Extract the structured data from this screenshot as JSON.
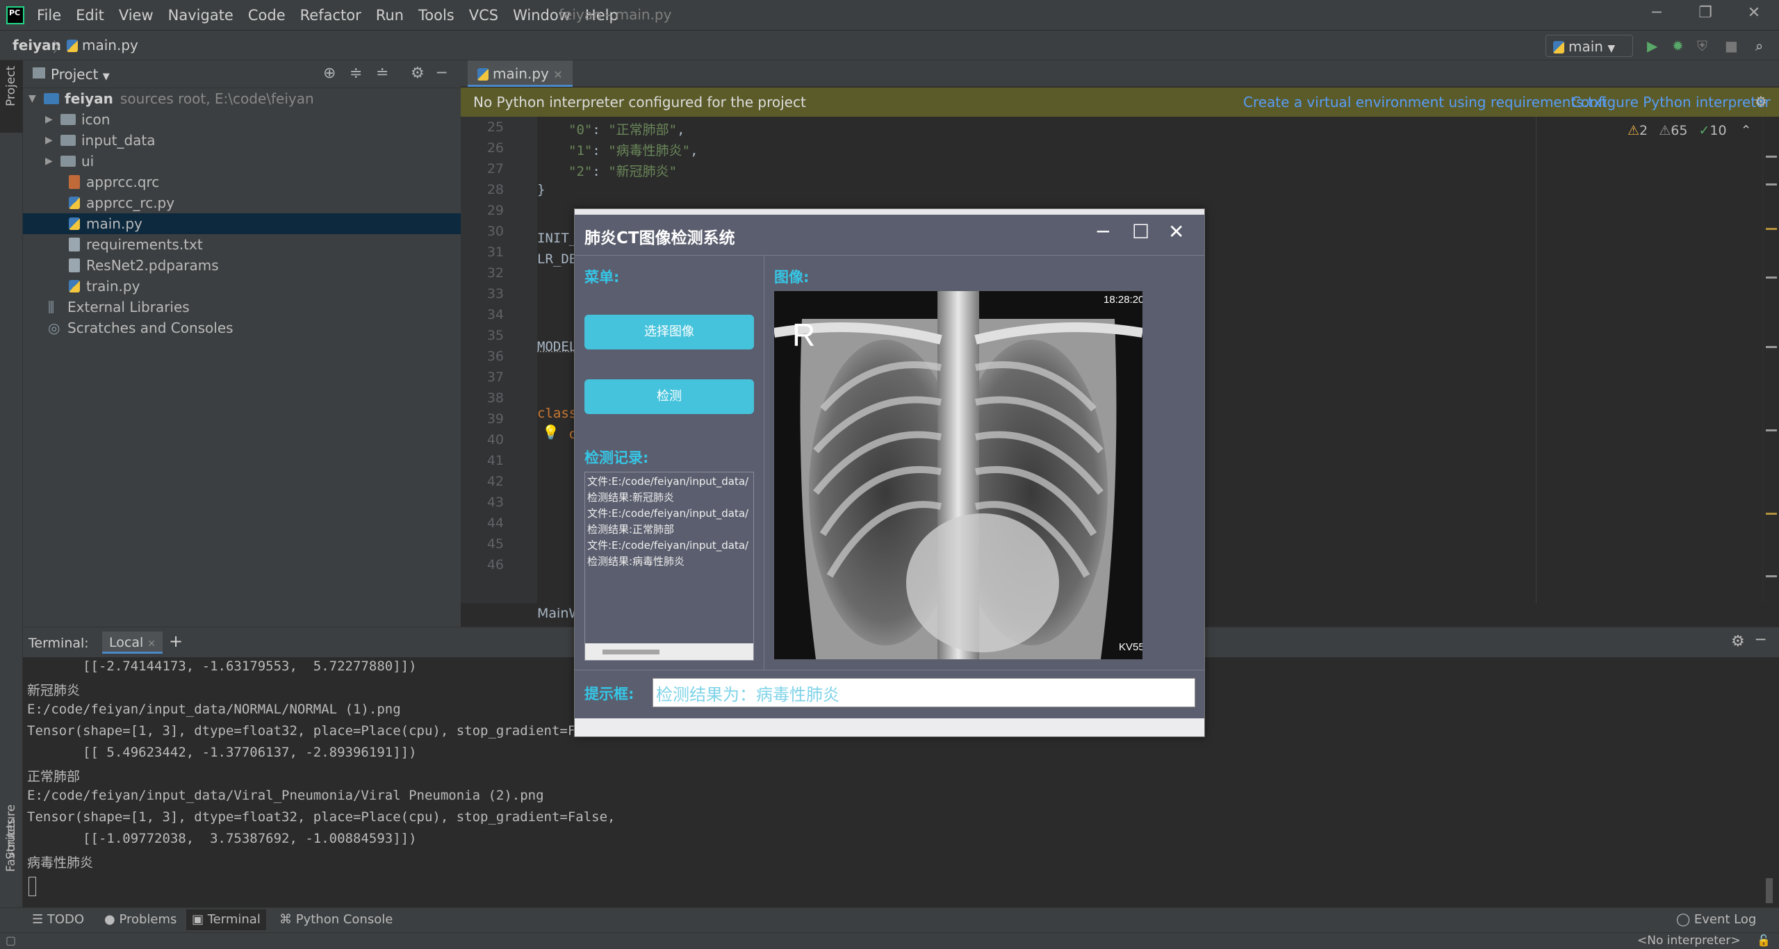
{
  "menu": [
    "File",
    "Edit",
    "View",
    "Navigate",
    "Code",
    "Refactor",
    "Run",
    "Tools",
    "VCS",
    "Window",
    "Help"
  ],
  "window_title": "feiyan - main.py",
  "nav": {
    "project": "feiyan",
    "file": "main.py",
    "run_config": "main"
  },
  "project_panel": {
    "title": "Project",
    "root_name": "feiyan",
    "root_hint": "sources root,  E:\\code\\feiyan",
    "folders": [
      "icon",
      "input_data",
      "ui"
    ],
    "files": [
      "apprcc.qrc",
      "apprcc_rc.py",
      "main.py",
      "requirements.txt",
      "ResNet2.pdparams",
      "train.py"
    ],
    "external": "External Libraries",
    "scratches": "Scratches and Consoles"
  },
  "editor": {
    "tab": "main.py",
    "banner_message": "No Python interpreter configured for the project",
    "banner_link_1": "Create a virtual environment using requirements.txt",
    "banner_link_2": "Configure Python interpreter",
    "inspections": {
      "warnings": "2",
      "weak": "65",
      "typos": "10"
    },
    "line_numbers": [
      "25",
      "26",
      "27",
      "28",
      "29",
      "30",
      "31",
      "32",
      "33",
      "34",
      "35",
      "36",
      "37",
      "38",
      "39",
      "40",
      "41",
      "42",
      "43",
      "44",
      "45",
      "46"
    ],
    "code_lines": {
      "l25_key": "\"0\"",
      "l25_val": "\"正常肺部\"",
      "l26_key": "\"1\"",
      "l26_val": "\"病毒性肺炎\"",
      "l27_key": "\"2\"",
      "l27_val": "\"新冠肺炎\"",
      "l28": "}",
      "l30": "INIT_",
      "l31": "LR_DE",
      "l35": "MODEL",
      "l38": "class",
      "l39": "d"
    },
    "breadcrumb": "MainW"
  },
  "terminal": {
    "label": "Terminal:",
    "tab": "Local",
    "lines": [
      "       [[-2.74144173, -1.63179553,  5.72277880]])",
      "新冠肺炎",
      "E:/code/feiyan/input_data/NORMAL/NORMAL (1).png",
      "Tensor(shape=[1, 3], dtype=float32, place=Place(cpu), stop_gradient=False,",
      "       [[ 5.49623442, -1.37706137, -2.89396191]])",
      "正常肺部",
      "E:/code/feiyan/input_data/Viral_Pneumonia/Viral Pneumonia (2).png",
      "Tensor(shape=[1, 3], dtype=float32, place=Place(cpu), stop_gradient=False,",
      "       [[-1.09772038,  3.75387692, -1.00884593]])",
      "病毒性肺炎"
    ]
  },
  "bottom_tabs": [
    "TODO",
    "Problems",
    "Terminal",
    "Python Console"
  ],
  "event_log": "Event Log",
  "status": {
    "interpreter": "<No interpreter>"
  },
  "left_strip": {
    "project": "Project",
    "structure": "Structure",
    "favorites": "Favorites"
  },
  "dialog": {
    "title": "肺炎CT图像检测系统",
    "menu_label": "菜单:",
    "select_button": "选择图像",
    "detect_button": "检测",
    "image_label": "图像:",
    "records_label": "检测记录:",
    "records": [
      "文件:E:/code/feiyan/input_data/",
      "检测结果:新冠肺炎",
      "文件:E:/code/feiyan/input_data/",
      "检测结果:正常肺部",
      "文件:E:/code/feiyan/input_data/",
      "检测结果:病毒性肺炎"
    ],
    "hint_label": "提示框:",
    "hint_value": "检测结果为：病毒性肺炎",
    "xray_time": "18:28:20",
    "xray_marker": "R",
    "xray_corner": "KV55"
  }
}
